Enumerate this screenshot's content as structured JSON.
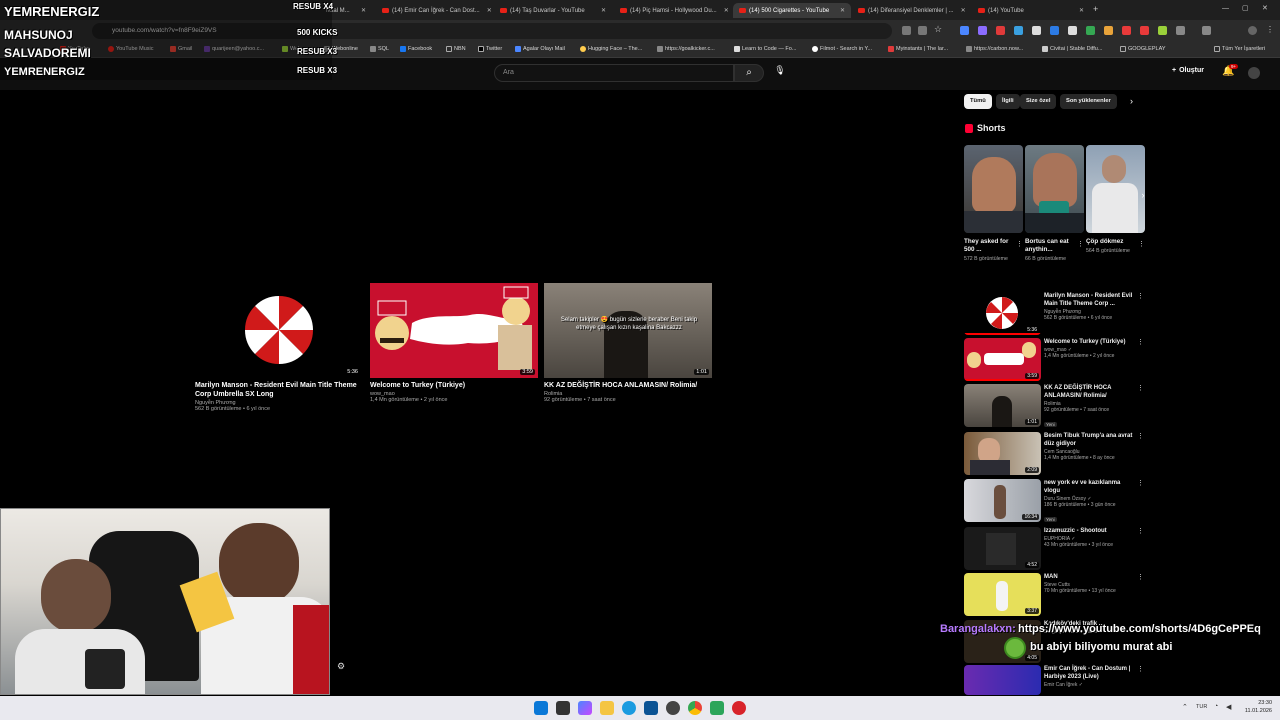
{
  "browser": {
    "tabs": [
      {
        "label": "ficial M...",
        "yt": false
      },
      {
        "label": "(14) Emir Can İğrek - Can Dost...",
        "yt": true
      },
      {
        "label": "(14) Taş Duvarlar - YouTube",
        "yt": true
      },
      {
        "label": "(14) Piç Hamsi - Hollywood Du...",
        "yt": true
      },
      {
        "label": "(14) 500 Cigarettes - YouTube",
        "yt": true,
        "active": true
      },
      {
        "label": "(14) Diferansiyel Denklemler | ...",
        "yt": true
      },
      {
        "label": "(14) YouTube",
        "yt": true
      }
    ],
    "url": "youtube.com/watch?v=fn8F9eiZ9VS",
    "bookmarks": [
      "YouTube",
      "YouTube Music",
      "Gmail",
      "quarijeen@yahoo.c...",
      "Web...",
      "Webonline",
      "SQL",
      "Facebook",
      "NBN",
      "Twitter",
      "Agalar Olayı Mail",
      "Hugging Face – The...",
      "https://goalkicker.c...",
      "Learn to Code — Fo...",
      "Filmot - Search in Y...",
      "Myinstants | The lar...",
      "https://carbon.now...",
      "Civitai | Stable Diffu...",
      "GOOGLEPLAY"
    ],
    "bookmarks_all": "Tüm Yer İşaretleri"
  },
  "youtube": {
    "search_placeholder": "Ara",
    "create_label": "Oluştur",
    "notif_count": "9+"
  },
  "endcards": [
    {
      "title": "Marilyn Manson - Resident Evil Main Title Theme Corp Umbrella SX Long",
      "channel": "Nguyễn Phương",
      "meta": "562 B görüntüleme • 6 yıl önce",
      "duration": "5:36"
    },
    {
      "title": "Welcome to Turkey (Türkiye)",
      "channel": "wow_mao",
      "meta": "1,4 Mn görüntüleme • 2 yıl önce",
      "duration": "3:59"
    },
    {
      "title": "KK AZ DEĞİŞTİR HOCA ANLAMASIN/ Rolimia/",
      "channel": "Rolimia",
      "meta": "92 görüntüleme • 7 saat önce",
      "duration": "1:01",
      "overlay": "Selam takipler 😍 bugün sizlerle beraber Beni takip etmeye çalışan kızın kaşalina Bakcazzz"
    }
  ],
  "chips": [
    "Tümü",
    "İlgili",
    "Size özel",
    "Son yüklenenler"
  ],
  "shorts_title": "Shorts",
  "shorts": [
    {
      "title": "They asked for 500 ...",
      "views": "572 B görüntüleme"
    },
    {
      "title": "Bortus can eat anythin...",
      "views": "66 B görüntüleme"
    },
    {
      "title": "Çöp dökmez",
      "views": "564 B görüntüleme"
    }
  ],
  "recommendations": [
    {
      "title": "Marilyn Manson - Resident Evil Main Title Theme Corp ...",
      "channel": "Nguyễn Phương",
      "meta": "562 B görüntüleme • 6 yıl önce",
      "duration": "5:36",
      "watched": 1.0
    },
    {
      "title": "Welcome to Turkey (Türkiye)",
      "channel": "wow_mao ✓",
      "meta": "1,4 Mn görüntüleme • 2 yıl önce",
      "duration": "3:59",
      "watched": 1.0
    },
    {
      "title": "KK AZ DEĞİŞTİR HOCA ANLAMASIN/ Rolimia/",
      "channel": "Rolimia",
      "meta": "92 görüntüleme • 7 saat önce",
      "duration": "1:01",
      "badge": "Yeni"
    },
    {
      "title": "Besim Tibuk Trump'a ana avrat düz gidiyor",
      "channel": "Cem Sancaoğlu",
      "meta": "1,4 Mn görüntüleme • 8 ay önce",
      "duration": "2:09"
    },
    {
      "title": "new york ev ve kazıklanma vlogu",
      "channel": "Duru Sinem Özsoy ✓",
      "meta": "186 B görüntüleme • 3 gün önce",
      "duration": "16:34",
      "badge": "Yeni"
    },
    {
      "title": "Izzamuzzic - Shootout",
      "channel": "EUPHORIA ✓",
      "meta": "43 Mn görüntüleme • 3 yıl önce",
      "duration": "4:52"
    },
    {
      "title": "MAN",
      "channel": "Steve Cutts",
      "meta": "70 Mn görüntüleme • 13 yıl önce",
      "duration": "3:37"
    },
    {
      "title": "Kadıköy'deki trafik ...",
      "channel": "Dergisiyim Haber Ajansı",
      "meta": "",
      "duration": "4:05"
    },
    {
      "title": "Emir Can İğrek - Can Dostum | Harbiye 2023 (Live)",
      "channel": "Emir Can İğrek ✓",
      "meta": "",
      "duration": ""
    }
  ],
  "stream": {
    "left_names": [
      "YEMRENERGIZ",
      "MAHSUNOJ",
      "SALVADOREMI",
      "YEMRENERGIZ"
    ],
    "resub": [
      "RESUB X4",
      "500 KICKS",
      "RESUB X3",
      "RESUB X3"
    ],
    "chat_user": "Barangalakxn:",
    "chat_msg1": "https://www.youtube.com/shorts/4D6gCePPEq",
    "chat_msg2": "bu abiyi biliyomu murat abi"
  },
  "taskbar": {
    "time": "23:30",
    "date": "11.01.2026",
    "lang": "TUR"
  },
  "colors": {
    "yt_red": "#ff0000",
    "chat_user": "#b77bff",
    "bg": "#0f0f0f"
  }
}
